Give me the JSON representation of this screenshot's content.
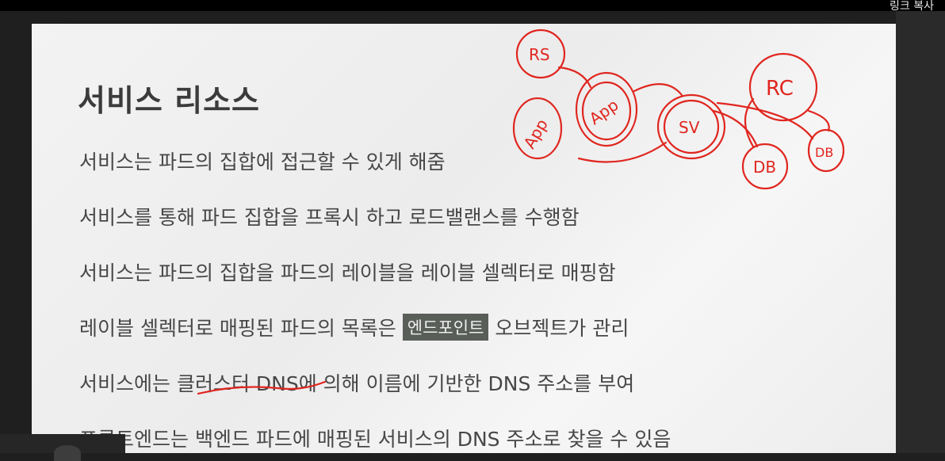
{
  "toolbar": {
    "link_copy_label": "링크 복사"
  },
  "slide": {
    "title": "서비스 리소스",
    "bullets": [
      "서비스는 파드의 집합에 접근할 수 있게 해줌",
      "서비스를 통해 파드 집합을 프록시 하고 로드밸랜스를 수행함",
      "서비스는 파드의 집합을 파드의 레이블을 레이블 셀렉터로 매핑함"
    ],
    "bullet4": {
      "before": "레이블 셀렉터로 매핑된 파드의 목록은",
      "tag": "엔드포인트",
      "after": "오브젝트가 관리"
    },
    "bullet5": "서비스에는 클러스터 DNS에 의해 이름에 기반한 DNS 주소를 부여",
    "bullet6": "프론트엔드는 백엔드 파드에 매핑된 서비스의 DNS 주소로 찾을 수 있음"
  },
  "annotations": {
    "labels": [
      "RS",
      "App",
      "App",
      "SV",
      "RC",
      "DB",
      "DB"
    ],
    "color": "#e0261f"
  }
}
